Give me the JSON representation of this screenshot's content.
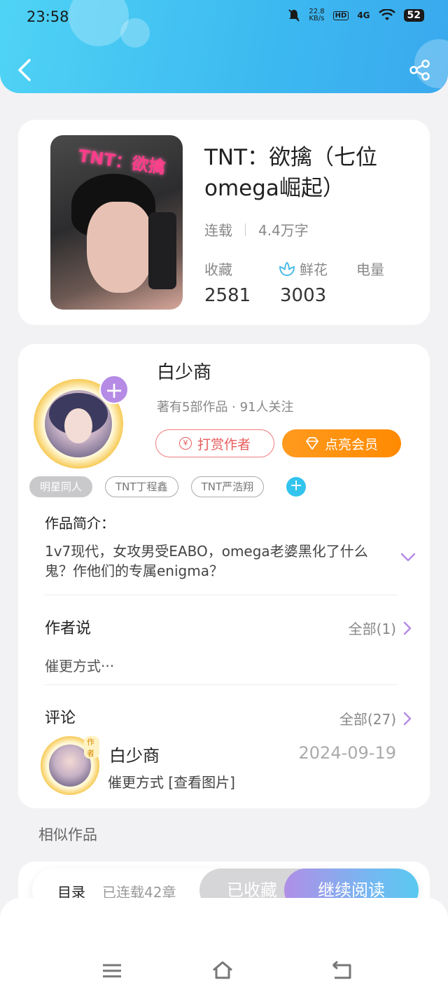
{
  "status": {
    "time": "23:58",
    "net_speed_top": "22.8",
    "net_speed_unit": "KB/s",
    "hd": "HD",
    "network": "4G",
    "battery": "52"
  },
  "book": {
    "cover_text": "TNT：欲擒",
    "title": "TNT：欲擒（七位omega崛起）",
    "state": "连载",
    "words": "4.4万字",
    "stats": [
      {
        "label": "收藏",
        "value": "2581"
      },
      {
        "label": "鲜花",
        "value": "3003",
        "icon": "flower-icon"
      },
      {
        "label": "电量",
        "value": ""
      }
    ]
  },
  "author": {
    "name": "白少商",
    "sub": "著有5部作品 · 91人关注",
    "reward_label": "打赏作者",
    "vip_label": "点亮会员"
  },
  "tags": [
    "明星同人",
    "TNT丁程鑫",
    "TNT严浩翔"
  ],
  "intro": {
    "title": "作品简介：",
    "text": "1v7现代，女攻男受EABO，omega老婆黑化了什么鬼？作他们的专属enigma？"
  },
  "author_say": {
    "title": "作者说",
    "all": "全部(1)",
    "text": "催更方式···"
  },
  "comments": {
    "title": "评论",
    "all": "全部(27)",
    "items": [
      {
        "tag": "作者",
        "name": "白少商",
        "date": "2024-09-19",
        "text": "催更方式 [查看图片]"
      }
    ]
  },
  "similar_title": "相似作品",
  "action_bar": {
    "toc": "目录",
    "toc_sub": "已连载42章",
    "fav": "已收藏",
    "read": "继续阅读"
  },
  "colors": {
    "header_start": "#4fd3f5",
    "header_end": "#3aa9ee",
    "vip": "#ff8a00",
    "reward": "#e85b5b",
    "plus_purple": "#b58be6",
    "tag_add": "#33c4ee"
  }
}
